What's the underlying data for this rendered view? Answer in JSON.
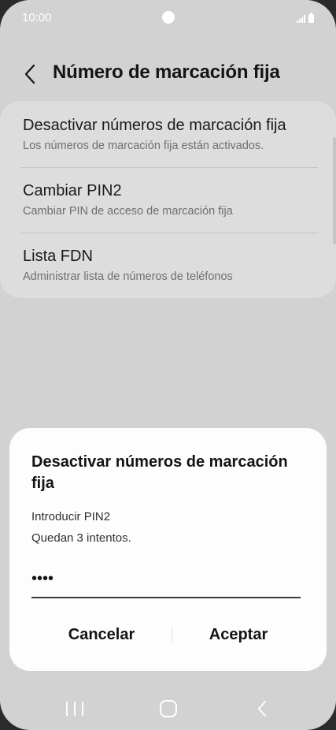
{
  "status_bar": {
    "time": "10:00"
  },
  "header": {
    "title": "Número de marcación fija",
    "back_icon": "chevron-left-icon"
  },
  "settings": {
    "items": [
      {
        "title": "Desactivar números de marcación fija",
        "subtitle": "Los números de marcación fija están activados."
      },
      {
        "title": "Cambiar PIN2",
        "subtitle": "Cambiar PIN de acceso de marcación fija"
      },
      {
        "title": "Lista FDN",
        "subtitle": "Administrar lista de números de teléfonos"
      }
    ]
  },
  "dialog": {
    "title": "Desactivar números de marcación fija",
    "prompt": "Introducir PIN2",
    "attempts": "Quedan 3 intentos.",
    "pin_masked": "••••",
    "cancel_label": "Cancelar",
    "ok_label": "Aceptar"
  },
  "nav_bar": {
    "icons": [
      "recent-apps-icon",
      "home-icon",
      "back-icon"
    ]
  },
  "colors": {
    "background_dim": "#d2d2d2",
    "card": "#dddddd",
    "dialog": "#fdfdfd",
    "text_primary": "#141414",
    "text_secondary": "#6f6f6f"
  }
}
